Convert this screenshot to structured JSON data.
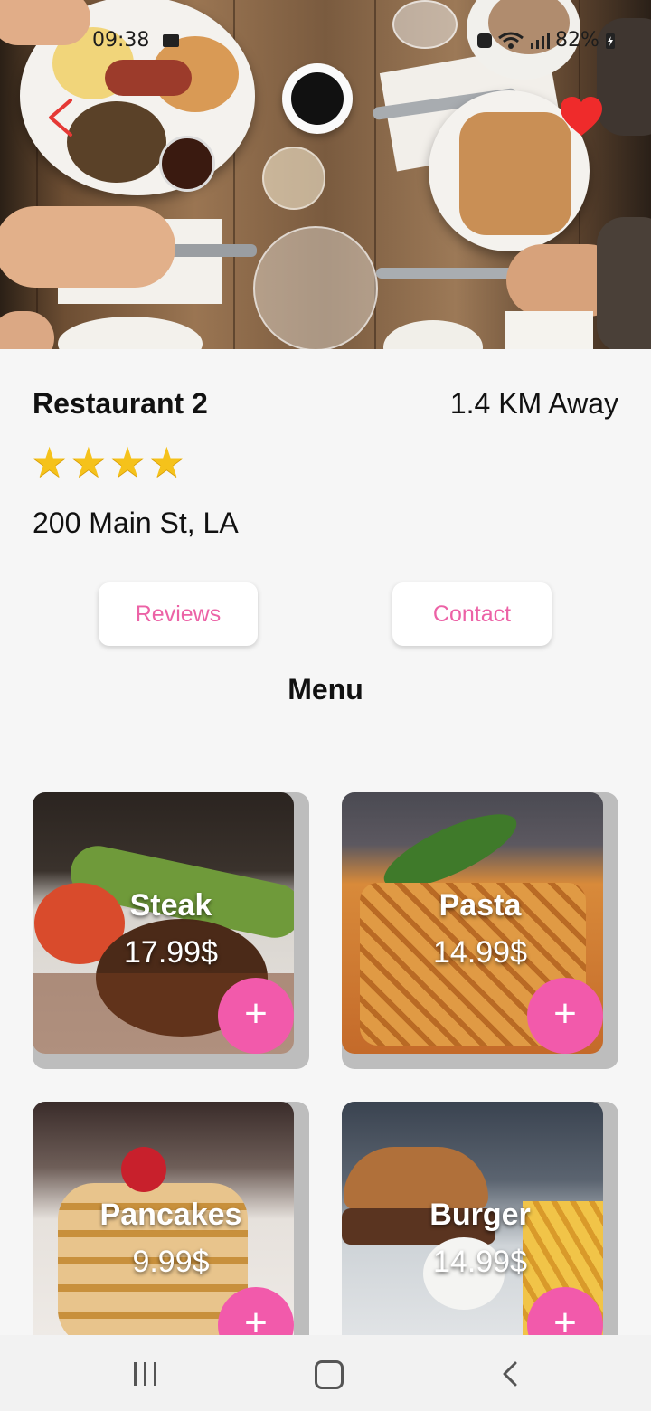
{
  "status_bar": {
    "time": "09:38",
    "battery": "82%",
    "left_icon": "image-icon",
    "right_icons": [
      "notification-icon",
      "wifi-icon",
      "signal-icon",
      "battery-charging-icon"
    ]
  },
  "header": {
    "back_icon": "chevron-left-icon",
    "favorite_icon": "heart-icon",
    "favorite_color": "#ef2b2b"
  },
  "restaurant": {
    "name": "Restaurant 2",
    "distance": "1.4 KM Away",
    "rating": 4,
    "address": "200 Main St, LA"
  },
  "actions": {
    "reviews_label": "Reviews",
    "contact_label": "Contact"
  },
  "menu": {
    "title": "Menu",
    "items": [
      {
        "name": "Steak",
        "price": "17.99$"
      },
      {
        "name": "Pasta",
        "price": "14.99$"
      },
      {
        "name": "Pancakes",
        "price": "9.99$"
      },
      {
        "name": "Burger",
        "price": "14.99$"
      }
    ],
    "add_label": "+"
  },
  "colors": {
    "accent": "#f25aab",
    "button_text": "#ec62a6",
    "star": "#f5c21b"
  },
  "nav_bar": {
    "icons": [
      "recent-apps-icon",
      "home-icon",
      "back-icon"
    ]
  }
}
